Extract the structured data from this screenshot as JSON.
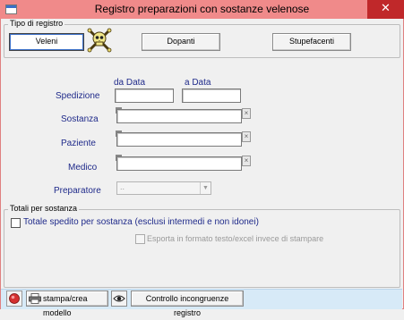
{
  "window": {
    "title": "Registro preparazioni con sostanze velenose",
    "close_glyph": "✕"
  },
  "tipo_registro": {
    "legend": "Tipo di registro",
    "buttons": [
      {
        "label": "Veleni",
        "active": true
      },
      {
        "label": "Dopanti",
        "active": false
      },
      {
        "label": "Stupefacenti",
        "active": false
      }
    ],
    "poison_icon": "skull-crossbones-icon"
  },
  "filters": {
    "da_data_label": "da Data",
    "a_data_label": "a Data",
    "spedizione_label": "Spedizione",
    "sostanza_label": "Sostanza",
    "paziente_label": "Paziente",
    "medico_label": "Medico",
    "preparatore_label": "Preparatore",
    "preparatore_value": "..",
    "da_data_value": "",
    "a_data_value": "",
    "sostanza_value": "",
    "paziente_value": "",
    "medico_value": ""
  },
  "totali": {
    "legend": "Totali per sostanza",
    "totale_label": "Totale spedito per sostanza (esclusi intermedi e non idonei)",
    "totale_checked": false,
    "esporta_label": "Esporta in formato testo/excel invece di stampare",
    "esporta_checked": false
  },
  "bottom_bar": {
    "stampa_label": "stampa/crea modello",
    "controllo_label": "Controllo incongruenze registro"
  },
  "colors": {
    "title_bar": "#f08a8a",
    "close_button": "#c0282a",
    "label_text": "#1f2a8a",
    "bottom_bar": "#d7eaf7"
  }
}
